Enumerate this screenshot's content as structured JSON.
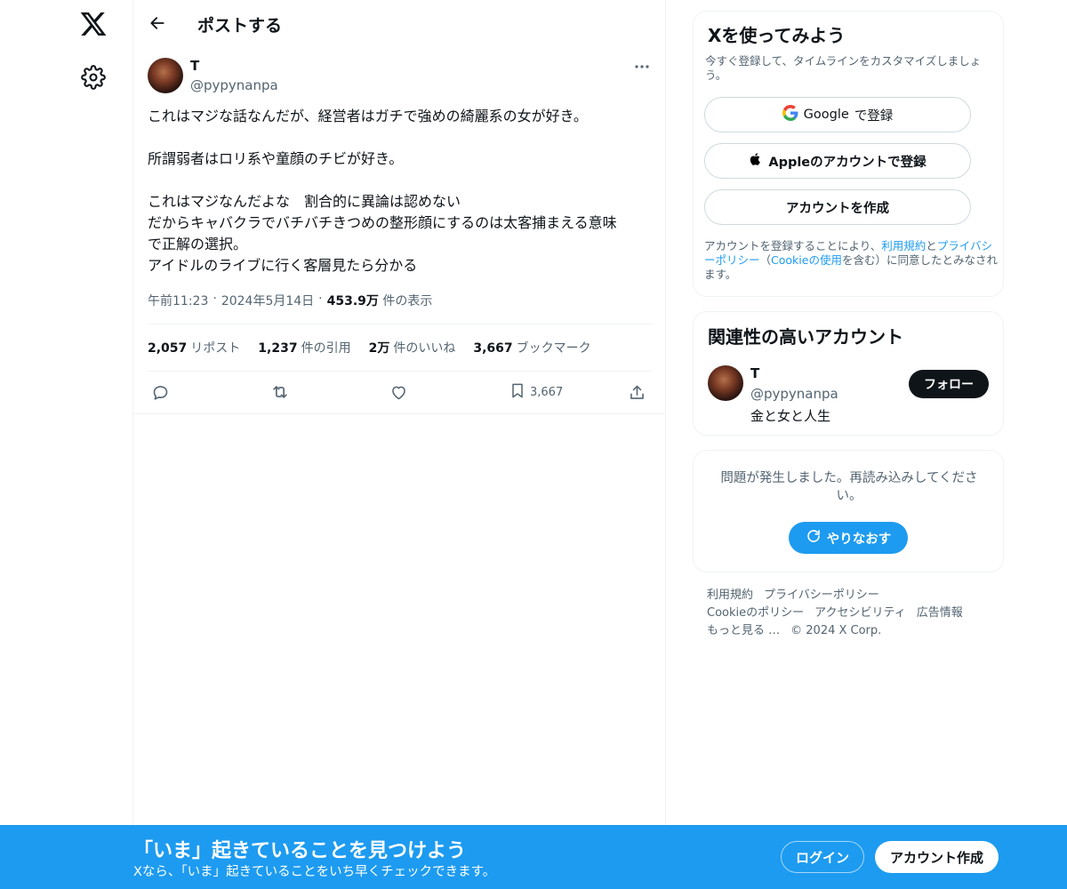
{
  "nav": {
    "logo_icon": "x-logo-icon",
    "settings_icon": "gear-icon"
  },
  "header": {
    "title": "ポストする",
    "back_icon": "arrow-left-icon"
  },
  "post": {
    "author_name": "T",
    "author_handle": "@pypynanpa",
    "lines": [
      "これはマジな話なんだが、経営者はガチで強めの綺麗系の女が好き。",
      "",
      "所謂弱者はロリ系や童顔のチビが好き。",
      "",
      "これはマジなんだよな　割合的に異論は認めない",
      "だからキャバクラでバチバチきつめの整形顔にするのは太客捕まえる意味",
      "で正解の選択。",
      "アイドルのライブに行く客層見たら分かる"
    ],
    "time": "午前11:23",
    "date": "2024年5月14日",
    "views_count": "453.9万",
    "views_label": "件の表示",
    "stats": {
      "reposts_count": "2,057",
      "reposts_label": "リポスト",
      "quotes_count": "1,237",
      "quotes_label": "件の引用",
      "likes_count": "2万",
      "likes_label": "件のいいね",
      "bookmarks_count": "3,667",
      "bookmarks_label": "ブックマーク"
    },
    "actions": {
      "bookmark_count": "3,667"
    }
  },
  "signup_card": {
    "title": "Xを使ってみよう",
    "subtitle": "今すぐ登録して、タイムラインをカスタマイズしましょう。",
    "google_brand": "Google",
    "google_suffix": "で登録",
    "apple_label": "Appleのアカウントで登録",
    "create_label": "アカウントを作成",
    "legal_1": "アカウントを登録することにより、",
    "legal_terms": "利用規約",
    "legal_and": "と",
    "legal_privacy": "プライバシーポリシー",
    "legal_paren_open": "（",
    "legal_cookie": "Cookieの使用",
    "legal_2": "を含む）に同意したとみなされます。"
  },
  "related_card": {
    "title": "関連性の高いアカウント",
    "name": "T",
    "handle": "@pypynanpa",
    "bio": "金と女と人生",
    "follow_label": "フォロー"
  },
  "error_card": {
    "message": "問題が発生しました。再読み込みしてください。",
    "retry_label": "やりなおす"
  },
  "footer": {
    "terms": "利用規約",
    "privacy": "プライバシーポリシー",
    "cookie": "Cookieのポリシー",
    "accessibility": "アクセシビリティ",
    "ads": "広告情報",
    "more": "もっと見る …",
    "copyright": "© 2024 X Corp."
  },
  "banner": {
    "title": "「いま」起きていることを見つけよう",
    "subtitle": "Xなら、「いま」起きていることをいち早くチェックできます。",
    "login_label": "ログイン",
    "create_label": "アカウント作成"
  },
  "colors": {
    "accent": "#1d9bf0",
    "text": "#0f1419",
    "muted": "#536471",
    "border": "#eff3f4"
  }
}
